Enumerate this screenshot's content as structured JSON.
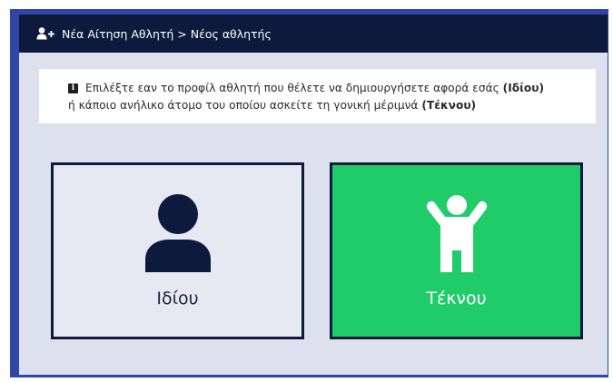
{
  "header": {
    "breadcrumb": "Νέα Αίτηση Αθλητή > Νέος αθλητής",
    "icon": "user-plus-icon"
  },
  "info": {
    "icon": "info-icon",
    "text_a": "Επιλέξτε εαν το προφίλ αθλητή που θέλετε να δημιουργήσετε αφορά εσάς ",
    "bold_a": "(Ιδίου)",
    "text_b": "ή κάποιο ανήλικο άτομο του οποίου ασκείτε τη γονική μέριμνά ",
    "bold_b": "(Τέκνου)"
  },
  "options": {
    "self": {
      "label": "Ιδίου",
      "icon": "user-icon"
    },
    "child": {
      "label": "Τέκνου",
      "icon": "child-icon"
    }
  },
  "colors": {
    "header_bg": "#0e1a3d",
    "panel_bg": "#dde1ee",
    "child_card_bg": "#1fcc69",
    "border": "#0e1a3d"
  }
}
